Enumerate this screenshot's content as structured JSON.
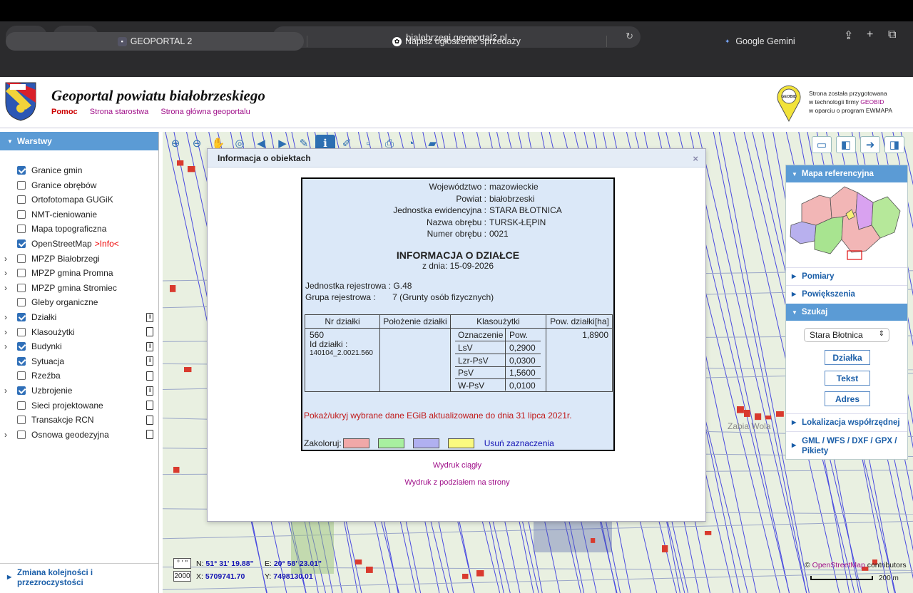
{
  "browser": {
    "url": "bialobrzegi.geoportal2.pl",
    "tabs": [
      {
        "label": "GEOPORTAL 2",
        "active": true
      },
      {
        "label": "Napisz ogłoszenie sprzedaży",
        "active": false
      },
      {
        "label": "Google Gemini",
        "active": false
      }
    ]
  },
  "header": {
    "title": "Geoportal powiatu białobrzeskiego",
    "nav": [
      "Pomoc",
      "Strona starostwa",
      "Strona główna geoportalu"
    ],
    "geobid": {
      "logo_text": "GEOBID",
      "line1": "Strona została przygotowana",
      "line2_prefix": "w technologii firmy ",
      "line2_brand": "GEOBID",
      "line3": "w oparciu o program EWMAPA"
    }
  },
  "layers_panel": {
    "title": "Warstwy",
    "items": [
      {
        "name": "Granice gmin",
        "checked": true,
        "expandable": false,
        "doc": "none"
      },
      {
        "name": "Granice obrębów",
        "checked": false,
        "expandable": false,
        "doc": "none"
      },
      {
        "name": "Ortofotomapa GUGiK",
        "checked": false,
        "expandable": false,
        "doc": "none"
      },
      {
        "name": "NMT-cieniowanie",
        "checked": false,
        "expandable": false,
        "doc": "none"
      },
      {
        "name": "Mapa topograficzna",
        "checked": false,
        "expandable": false,
        "doc": "none"
      },
      {
        "name": "OpenStreetMap",
        "checked": true,
        "expandable": false,
        "doc": "none",
        "extra": ">Info<"
      },
      {
        "name": "MPZP Białobrzegi",
        "checked": false,
        "expandable": true,
        "doc": "none"
      },
      {
        "name": "MPZP gmina Promna",
        "checked": false,
        "expandable": true,
        "doc": "none"
      },
      {
        "name": "MPZP gmina Stromiec",
        "checked": false,
        "expandable": true,
        "doc": "none"
      },
      {
        "name": "Gleby organiczne",
        "checked": false,
        "expandable": false,
        "doc": "none"
      },
      {
        "name": "Działki",
        "checked": true,
        "expandable": true,
        "doc": "info"
      },
      {
        "name": "Klasoużytki",
        "checked": false,
        "expandable": true,
        "doc": "plain"
      },
      {
        "name": "Budynki",
        "checked": true,
        "expandable": true,
        "doc": "info"
      },
      {
        "name": "Sytuacja",
        "checked": true,
        "expandable": false,
        "doc": "info"
      },
      {
        "name": "Rzeźba",
        "checked": false,
        "expandable": false,
        "doc": "plain"
      },
      {
        "name": "Uzbrojenie",
        "checked": true,
        "expandable": true,
        "doc": "info"
      },
      {
        "name": "Sieci projektowane",
        "checked": false,
        "expandable": false,
        "doc": "plain"
      },
      {
        "name": "Transakcje RCN",
        "checked": false,
        "expandable": false,
        "doc": "plain"
      },
      {
        "name": "Osnowa geodezyjna",
        "checked": false,
        "expandable": true,
        "doc": "plain"
      }
    ],
    "order_link_line1": "Zmiana kolejności i",
    "order_link_line2": "przezroczystości"
  },
  "dialog": {
    "title": "Informacja o obiektach",
    "close": "×",
    "fields": [
      {
        "label": "Województwo :",
        "value": "mazowieckie"
      },
      {
        "label": "Powiat :",
        "value": "białobrzeski"
      },
      {
        "label": "Jednostka ewidencyjna :",
        "value": "STARA BŁOTNICA"
      },
      {
        "label": "Nazwa obrębu :",
        "value": "TURSK-ŁĘPIN"
      },
      {
        "label": "Numer obrębu :",
        "value": "0021"
      }
    ],
    "info_title": "INFORMACJA O DZIAŁCE",
    "info_date": "z dnia: 15-09-2026",
    "register_unit_label": "Jednostka rejestrowa :",
    "register_unit_value": "G.48",
    "register_group_label": "Grupa rejestrowa :",
    "register_group_value": "7 (Grunty osób fizycznych)",
    "table": {
      "headers": [
        "Nr działki",
        "Położenie działki",
        "Klasoużytki",
        "Pow. działki[ha]"
      ],
      "parcel_number": "560",
      "parcel_id_label": "Id działki :",
      "parcel_id": "140104_2.0021.560",
      "parcel_location": "",
      "area": "1,8900",
      "class_headers": [
        "Oznaczenie",
        "Pow."
      ],
      "classes": [
        {
          "symbol": "LsV",
          "area": "0,2900"
        },
        {
          "symbol": "Lzr-PsV",
          "area": "0,0300"
        },
        {
          "symbol": "PsV",
          "area": "1,5600"
        },
        {
          "symbol": "W-PsV",
          "area": "0,0100"
        }
      ]
    },
    "egib_toggle": "Pokaż/ukryj wybrane dane EGiB aktualizowane do dnia 31 lipca 2021r.",
    "color_label": "Zakoloruj:",
    "swatches": [
      "#f0a8a8",
      "#a8f0a0",
      "#b0b0f0",
      "#fafa80"
    ],
    "clear_selection": "Usuń zaznaczenia",
    "print_continuous": "Wydruk ciągły",
    "print_pages": "Wydruk z podziałem na strony"
  },
  "right_panel": {
    "reference_map": "Mapa referencyjna",
    "measurements": "Pomiary",
    "zoom": "Powiększenia",
    "search": "Szukaj",
    "gmina_selected": "Stara Błotnica",
    "search_buttons": [
      "Działka",
      "Tekst",
      "Adres"
    ],
    "coord_location": "Lokalizacja współrzędnej",
    "export_line1": "GML / WFS / DXF / GPX /",
    "export_line2": "Pikiety"
  },
  "coordinates": {
    "unit_box": "° ' \"",
    "n_label": "N:",
    "n_value": "51° 31' 19.88\"",
    "e_label": "E:",
    "e_value": "20° 58' 23.01\"",
    "system": "2000",
    "x_label": "X:",
    "x_value": "5709741.70",
    "y_label": "Y:",
    "y_value": "7498130.01"
  },
  "map_labels": {
    "place": "Zabia Wola",
    "attribution_prefix": "© ",
    "attribution_link": "OpenStreetMap",
    "attribution_suffix": " contributors",
    "scale": "200 m"
  }
}
